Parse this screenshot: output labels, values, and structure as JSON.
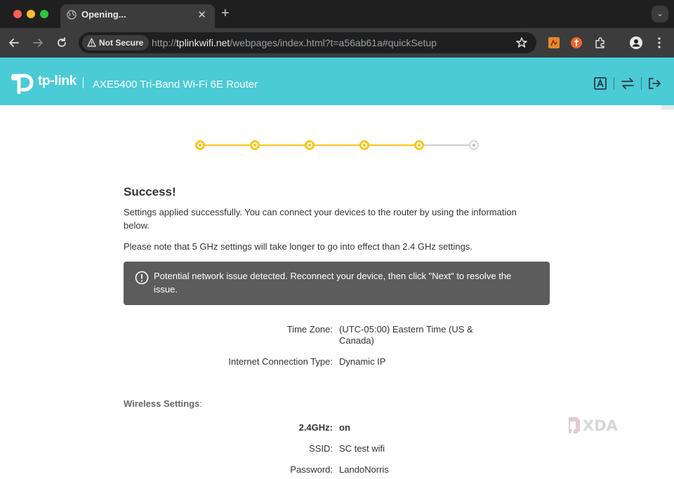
{
  "browser": {
    "tab_title": "Opening...",
    "security_label": "Not Secure",
    "url_scheme": "http://",
    "url_host": "tplinkwifi.net",
    "url_path": "/webpages/index.html?t=a56ab61a#quickSetup"
  },
  "header": {
    "brand": "tp-link",
    "separator": "|",
    "model": "AXE5400 Tri-Band Wi-Fi 6E Router",
    "icons": [
      "text-a-icon",
      "swap-arrows-icon",
      "logout-icon"
    ]
  },
  "progress": {
    "total_steps": 6,
    "completed_steps": 5,
    "color_done": "#fcc419",
    "color_todo": "#cccccc"
  },
  "main": {
    "title": "Success!",
    "message": "Settings applied successfully. You can connect your devices to the router by using the information below.",
    "note": "Please note that 5 GHz settings will take longer to go into effect than 2.4 GHz settings.",
    "alert": "Potential network issue detected. Reconnect your device, then click \"Next\" to resolve the issue."
  },
  "summary": {
    "time_zone_label": "Time Zone:",
    "time_zone_value": "(UTC-05:00) Eastern Time (US & Canada)",
    "connection_label": "Internet Connection Type:",
    "connection_value": "Dynamic IP",
    "wireless_label": "Wireless Settings",
    "wireless_colon": ":",
    "band_label": "2.4GHz:",
    "band_value": "on",
    "ssid_label": "SSID:",
    "ssid_value": "SC test wifi",
    "password_label": "Password:",
    "password_value": "LandoNorris"
  },
  "colors": {
    "header_bg": "#4acbd6",
    "alert_bg": "#5c5c5c"
  },
  "watermark": "XDA"
}
